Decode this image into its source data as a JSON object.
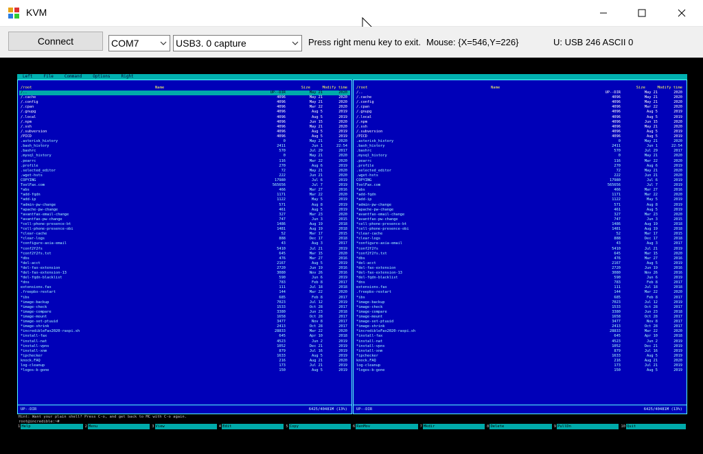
{
  "window": {
    "title": "KVM",
    "icon": "kvm-app-icon",
    "controls": [
      "minimize-icon",
      "maximize-icon",
      "close-icon"
    ]
  },
  "toolbar": {
    "connect_label": "Connect",
    "port_value": "COM7",
    "device_value": "USB3. 0 capture",
    "help_text": "Press right menu key to exit.",
    "mouse_text": "Mouse: {X=546,Y=226}",
    "usb_text": "U: USB 246 ASCII 0"
  },
  "mc": {
    "menu": [
      "Left",
      "File",
      "Command",
      "Options",
      "Right"
    ],
    "columns": {
      "name": "Name",
      "size": "Size",
      "time": "Modify time"
    },
    "left_path": "/root",
    "right_path": "/root",
    "left_status": "UP--DIR",
    "right_status": "UP--DIR",
    "left_free": "6425/40481M (13%)",
    "right_free": "6425/40481M (13%)",
    "hint": "Hint: Want your plain shell? Press C-o, and get back to MC with C-o again.",
    "prompt": "root@incredible:~#",
    "files": [
      {
        "n": "/..",
        "s": "UP--DIR",
        "d": "May 21",
        "t": "2020",
        "dir": true
      },
      {
        "n": "/.cache",
        "s": "4096",
        "d": "May 21",
        "t": "2020",
        "dir": true
      },
      {
        "n": "/.config",
        "s": "4096",
        "d": "May 21",
        "t": "2020",
        "dir": true
      },
      {
        "n": "/.cpan",
        "s": "4096",
        "d": "Mar 22",
        "t": "2020",
        "dir": true
      },
      {
        "n": "/.gnupg",
        "s": "4096",
        "d": "Aug 5",
        "t": "2019",
        "dir": true
      },
      {
        "n": "/.local",
        "s": "4096",
        "d": "Aug 5",
        "t": "2019",
        "dir": true
      },
      {
        "n": "/.npm",
        "s": "4096",
        "d": "Jun 15",
        "t": "2020",
        "dir": true
      },
      {
        "n": "/.ssh",
        "s": "4096",
        "d": "May 21",
        "t": "2020",
        "dir": true
      },
      {
        "n": "/.subversion",
        "s": "4096",
        "d": "Aug 5",
        "t": "2019",
        "dir": true
      },
      {
        "n": "/PICD",
        "s": "4096",
        "d": "Aug 5",
        "t": "2019",
        "dir": true
      },
      {
        "n": " .asterisk_history",
        "s": "0",
        "d": "May 21",
        "t": "2020",
        "dir": false
      },
      {
        "n": " .bash_history",
        "s": "2411",
        "d": "Jun 1",
        "t": "22:54",
        "dir": false
      },
      {
        "n": " .bashrc",
        "s": "570",
        "d": "Jul 29",
        "t": "2017",
        "dir": false
      },
      {
        "n": " .mysql_history",
        "s": "0",
        "d": "May 21",
        "t": "2020",
        "dir": false
      },
      {
        "n": " .pearrc",
        "s": "116",
        "d": "Mar 22",
        "t": "2020",
        "dir": false
      },
      {
        "n": " .profile",
        "s": "270",
        "d": "Aug 6",
        "t": "2019",
        "dir": false
      },
      {
        "n": " .selected_editor",
        "s": "72",
        "d": "May 21",
        "t": "2020",
        "dir": false
      },
      {
        "n": " .wget-hsts",
        "s": "222",
        "d": "Jun 21",
        "t": "2020",
        "dir": false
      },
      {
        "n": " COPYING",
        "s": "17980",
        "d": "Jul 6",
        "t": "2019",
        "dir": false
      },
      {
        "n": " ToolFax.com",
        "s": "565656",
        "d": "Jul 7",
        "t": "2019",
        "dir": false
      },
      {
        "n": "*abs",
        "s": "466",
        "d": "Mar 27",
        "t": "2016",
        "dir": false
      },
      {
        "n": "*add-fqdn",
        "s": "1171",
        "d": "Mar 22",
        "t": "2020",
        "dir": false
      },
      {
        "n": "*add-ip",
        "s": "1122",
        "d": "May 5",
        "t": "2019",
        "dir": false
      },
      {
        "n": "*admin-pw-change",
        "s": "571",
        "d": "Aug 8",
        "t": "2019",
        "dir": false
      },
      {
        "n": "*apache-pw-change",
        "s": "461",
        "d": "Aug 5",
        "t": "2019",
        "dir": false
      },
      {
        "n": "*avantfax-email-change",
        "s": "327",
        "d": "Mar 23",
        "t": "2020",
        "dir": false
      },
      {
        "n": "*avantfax-pw-change",
        "s": "747",
        "d": "Jun 3",
        "t": "2015",
        "dir": false
      },
      {
        "n": "*cell-phone-presence-bt",
        "s": "1486",
        "d": "Aug 19",
        "t": "2018",
        "dir": false
      },
      {
        "n": "*cell-phone-presence-obi",
        "s": "1481",
        "d": "Aug 19",
        "t": "2018",
        "dir": false
      },
      {
        "n": "*clear-cache",
        "s": "52",
        "d": "Mar 17",
        "t": "2015",
        "dir": false
      },
      {
        "n": "*clear-logs",
        "s": "888",
        "d": "Dec 17",
        "t": "2018",
        "dir": false
      },
      {
        "n": "*configure-axia-email",
        "s": "43",
        "d": "Aug 3",
        "t": "2017",
        "dir": false
      },
      {
        "n": "*conf2f2fs",
        "s": "5410",
        "d": "Jul 21",
        "t": "2019",
        "dir": false
      },
      {
        "n": "*conf2f2fs.txt",
        "s": "645",
        "d": "Mar 15",
        "t": "2020",
        "dir": false
      },
      {
        "n": "*dbs",
        "s": "476",
        "d": "Mar 27",
        "t": "2016",
        "dir": false
      },
      {
        "n": "*del-acct",
        "s": "2167",
        "d": "Aug 5",
        "t": "2019",
        "dir": false
      },
      {
        "n": "*del-fax-extension",
        "s": "2720",
        "d": "Jun 19",
        "t": "2016",
        "dir": false
      },
      {
        "n": "*del-fax-extension-13",
        "s": "3080",
        "d": "Nov 26",
        "t": "2016",
        "dir": false
      },
      {
        "n": "*del-fqdn-blacklist",
        "s": "590",
        "d": "Jun 6",
        "t": "2019",
        "dir": false
      },
      {
        "n": "*dns",
        "s": "783",
        "d": "Feb 8",
        "t": "2017",
        "dir": false
      },
      {
        "n": " extensions.fax",
        "s": "111",
        "d": "Jul 18",
        "t": "2018",
        "dir": false
      },
      {
        "n": " .freepbx-restart",
        "s": "144",
        "d": "Mar 22",
        "t": "2020",
        "dir": false
      },
      {
        "n": "*ibs",
        "s": "685",
        "d": "Feb 8",
        "t": "2017",
        "dir": false
      },
      {
        "n": "*image-backup",
        "s": "7023",
        "d": "Jul 12",
        "t": "2019",
        "dir": false
      },
      {
        "n": "*image-check",
        "s": "1533",
        "d": "Oct 28",
        "t": "2017",
        "dir": false
      },
      {
        "n": "*image-compare",
        "s": "3380",
        "d": "Jun 23",
        "t": "2018",
        "dir": false
      },
      {
        "n": "*image-mount",
        "s": "1658",
        "d": "Oct 28",
        "t": "2017",
        "dir": false
      },
      {
        "n": "*image-set-ptuuid",
        "s": "3477",
        "d": "Nov 8",
        "t": "2017",
        "dir": false
      },
      {
        "n": "*image-shrink",
        "s": "2413",
        "d": "Oct 28",
        "t": "2017",
        "dir": false
      },
      {
        "n": "*incredibleFax2020-raspi.sh",
        "s": "28833",
        "d": "Mar 22",
        "t": "2020",
        "dir": false
      },
      {
        "n": "*install-fax",
        "s": "645",
        "d": "Apr 10",
        "t": "2018",
        "dir": false
      },
      {
        "n": "*install-nat",
        "s": "4523",
        "d": "Jun 2",
        "t": "2019",
        "dir": false
      },
      {
        "n": "*install-vpns",
        "s": "1052",
        "d": "Dec 21",
        "t": "2019",
        "dir": false
      },
      {
        "n": "*install-xnm",
        "s": "879",
        "d": "Jul 16",
        "t": "2019",
        "dir": false
      },
      {
        "n": "*ipchecker",
        "s": "1633",
        "d": "Aug 5",
        "t": "2019",
        "dir": false
      },
      {
        "n": " knock.FAQ",
        "s": "216",
        "d": "Aug 21",
        "t": "2020",
        "dir": false
      },
      {
        "n": " log-cleanup",
        "s": "173",
        "d": "Jul 21",
        "t": "2019",
        "dir": false
      },
      {
        "n": "*logos-b-gone",
        "s": "150",
        "d": "Aug 5",
        "t": "2019",
        "dir": false
      }
    ],
    "keys": [
      {
        "n": "1",
        "l": "Help"
      },
      {
        "n": "2",
        "l": "Menu"
      },
      {
        "n": "3",
        "l": "View"
      },
      {
        "n": "4",
        "l": "Edit"
      },
      {
        "n": "5",
        "l": "Copy"
      },
      {
        "n": "6",
        "l": "RenMov"
      },
      {
        "n": "7",
        "l": "Mkdir"
      },
      {
        "n": "8",
        "l": "Delete"
      },
      {
        "n": "9",
        "l": "PullDn"
      },
      {
        "n": "10",
        "l": "Quit"
      }
    ]
  },
  "colors": {
    "mc_bg": "#0000b0",
    "mc_accent": "#00aaaa",
    "toolbar_bg": "#f0f0f0"
  }
}
